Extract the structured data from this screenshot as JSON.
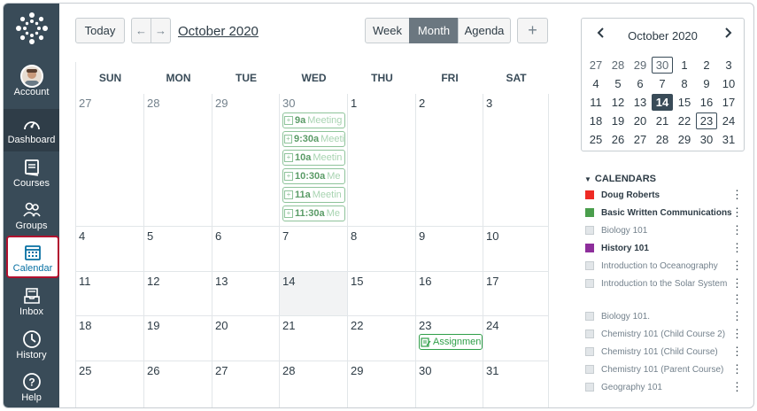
{
  "nav": {
    "items": [
      {
        "label": "Account",
        "icon": "avatar"
      },
      {
        "label": "Dashboard",
        "icon": "dashboard-icon"
      },
      {
        "label": "Courses",
        "icon": "courses-icon"
      },
      {
        "label": "Groups",
        "icon": "groups-icon"
      },
      {
        "label": "Calendar",
        "icon": "calendar-icon"
      },
      {
        "label": "Inbox",
        "icon": "inbox-icon"
      },
      {
        "label": "History",
        "icon": "history-icon"
      },
      {
        "label": "Help",
        "icon": "help-icon"
      }
    ],
    "active": "Calendar",
    "colors": {
      "bg": "#394b58",
      "active_border": "#b2102f",
      "active_text": "#0770a3"
    }
  },
  "header": {
    "today_label": "Today",
    "prev_label": "←",
    "next_label": "→",
    "month_title": "October 2020",
    "views": [
      "Week",
      "Month",
      "Agenda"
    ],
    "selected_view": "Month",
    "add_label": "+"
  },
  "calendar": {
    "weekdays": [
      "SUN",
      "MON",
      "TUE",
      "WED",
      "THU",
      "FRI",
      "SAT"
    ],
    "weeks": [
      [
        "27",
        "28",
        "29",
        "30",
        "1",
        "2",
        "3"
      ],
      [
        "4",
        "5",
        "6",
        "7",
        "8",
        "9",
        "10"
      ],
      [
        "11",
        "12",
        "13",
        "14",
        "15",
        "16",
        "17"
      ],
      [
        "18",
        "19",
        "20",
        "21",
        "22",
        "23",
        "24"
      ],
      [
        "25",
        "26",
        "27",
        "28",
        "29",
        "30",
        "31"
      ]
    ],
    "today": "14",
    "events": {
      "wed30": [
        {
          "time": "9a",
          "name": "Meeting"
        },
        {
          "time": "9:30a",
          "name": "Meeti"
        },
        {
          "time": "10a",
          "name": "Meetin"
        },
        {
          "time": "10:30a",
          "name": "Me"
        },
        {
          "time": "11a",
          "name": "Meetin"
        },
        {
          "time": "11:30a",
          "name": "Me"
        }
      ],
      "fri23": {
        "name": "Assignmen"
      }
    },
    "event_color": "#2f9e48"
  },
  "mini_calendar": {
    "title": "October 2020",
    "prev": "‹",
    "next": "›",
    "weeks": [
      [
        "27",
        "28",
        "29",
        "30",
        "1",
        "2",
        "3"
      ],
      [
        "4",
        "5",
        "6",
        "7",
        "8",
        "9",
        "10"
      ],
      [
        "11",
        "12",
        "13",
        "14",
        "15",
        "16",
        "17"
      ],
      [
        "18",
        "19",
        "20",
        "21",
        "22",
        "23",
        "24"
      ],
      [
        "25",
        "26",
        "27",
        "28",
        "29",
        "30",
        "31"
      ]
    ],
    "selected": "14",
    "boxed": [
      "30",
      "23"
    ]
  },
  "calendars": {
    "heading": "CALENDARS",
    "items": [
      {
        "name": "Doug Roberts",
        "color": "#ee2a24",
        "enabled": true
      },
      {
        "name": "Basic Written Communications",
        "color": "#4a9e4c",
        "enabled": true
      },
      {
        "name": "Biology 101",
        "color": "#e2e6e9",
        "enabled": false
      },
      {
        "name": "History 101",
        "color": "#8d2e9b",
        "enabled": true
      },
      {
        "name": "Introduction to Oceanography",
        "color": "#e2e6e9",
        "enabled": false
      },
      {
        "name": "Introduction to the Solar System",
        "color": "#e2e6e9",
        "enabled": false
      },
      {
        "name": "Biology 101.",
        "color": "#e2e6e9",
        "enabled": false
      },
      {
        "name": "Chemistry 101 (Child Course 2)",
        "color": "#e2e6e9",
        "enabled": false
      },
      {
        "name": "Chemistry 101 (Child Course)",
        "color": "#e2e6e9",
        "enabled": false
      },
      {
        "name": "Chemistry 101 (Parent Course)",
        "color": "#e2e6e9",
        "enabled": false
      },
      {
        "name": "Geography 101",
        "color": "#e2e6e9",
        "enabled": false
      }
    ]
  }
}
